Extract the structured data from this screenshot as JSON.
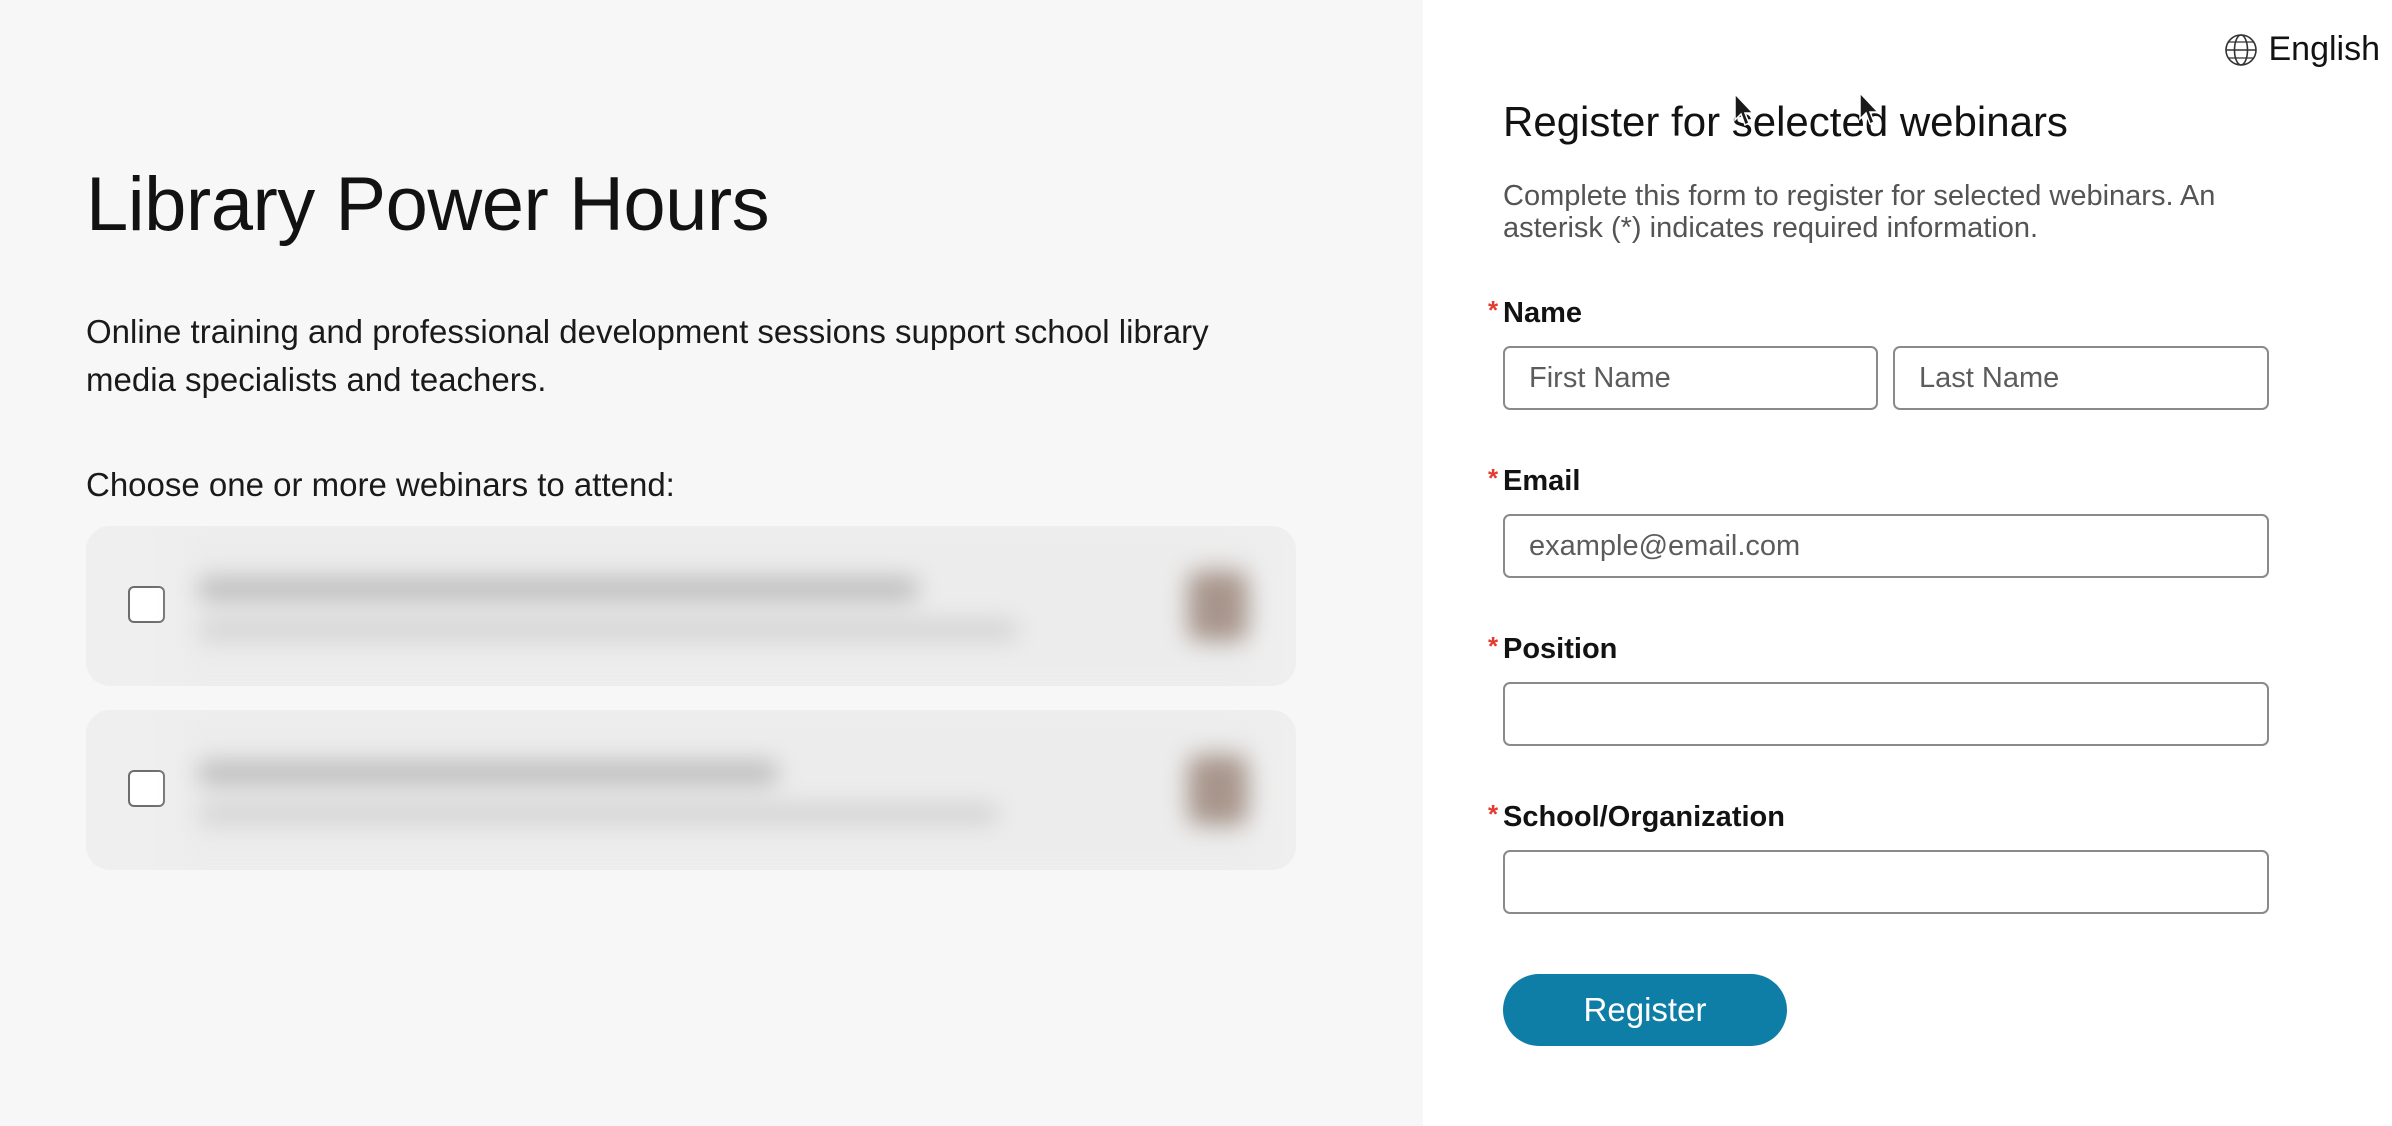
{
  "page": {
    "title": "Library Power Hours",
    "description": "Online training and professional development sessions support school library media specialists and teachers.",
    "choose_label": "Choose one or more webinars to attend:"
  },
  "webinars": [
    {
      "checked": false
    },
    {
      "checked": false
    }
  ],
  "language": {
    "label": "English",
    "icon": "globe-icon"
  },
  "form": {
    "title": "Register for selected webinars",
    "description": "Complete this form to register for selected webinars. An asterisk (*) indicates required information.",
    "required_marker": "*",
    "fields": {
      "name": {
        "label": "Name",
        "first_placeholder": "First Name",
        "last_placeholder": "Last Name",
        "first_value": "",
        "last_value": ""
      },
      "email": {
        "label": "Email",
        "placeholder": "example@email.com",
        "value": ""
      },
      "position": {
        "label": "Position",
        "placeholder": "",
        "value": ""
      },
      "organization": {
        "label": "School/Organization",
        "placeholder": "",
        "value": ""
      }
    },
    "submit_label": "Register"
  },
  "colors": {
    "accent": "#0f7ea6",
    "required": "#e23b32",
    "left_bg": "#f7f7f7",
    "card_bg": "#efefef"
  }
}
